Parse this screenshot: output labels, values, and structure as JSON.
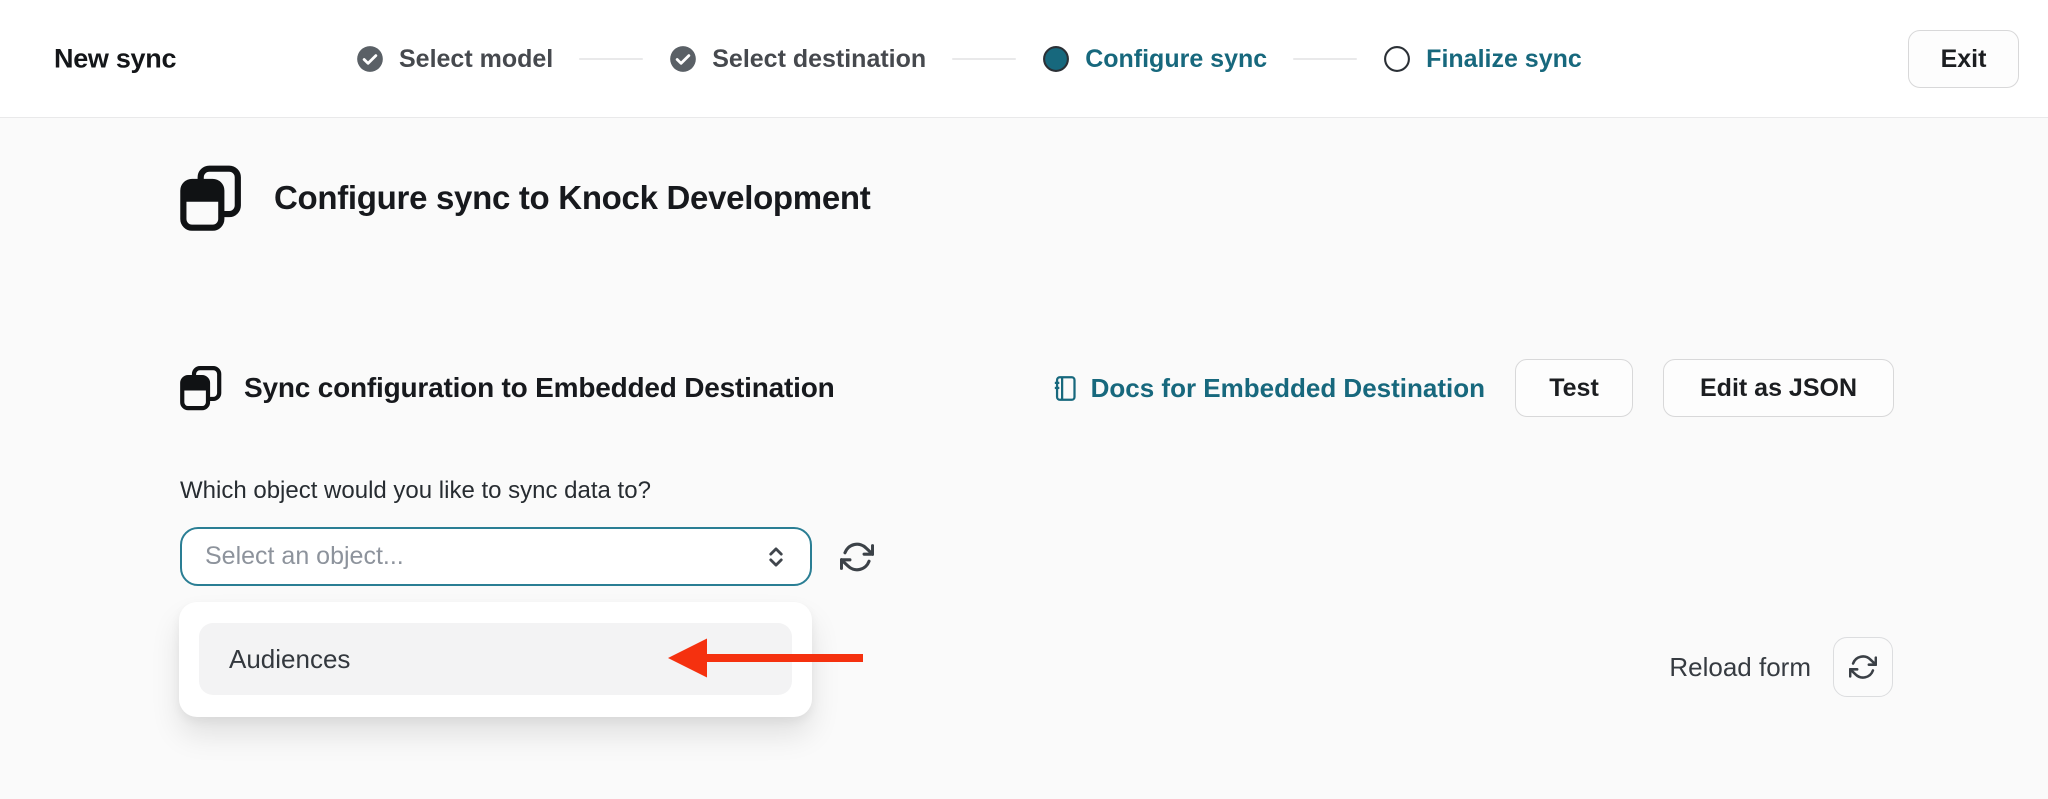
{
  "header": {
    "title": "New sync",
    "exit_label": "Exit",
    "steps": [
      {
        "label": "Select model",
        "state": "completed"
      },
      {
        "label": "Select destination",
        "state": "completed"
      },
      {
        "label": "Configure sync",
        "state": "current"
      },
      {
        "label": "Finalize sync",
        "state": "upcoming"
      }
    ]
  },
  "main": {
    "page_heading": "Configure sync to Knock Development",
    "section": {
      "title": "Sync configuration to Embedded Destination",
      "docs_link_label": "Docs for Embedded Destination",
      "test_button_label": "Test",
      "edit_json_button_label": "Edit as JSON"
    },
    "object_question": "Which object would you like to sync data to?",
    "object_select": {
      "placeholder": "Select an object..."
    },
    "dropdown": {
      "options": [
        "Audiences"
      ]
    },
    "reload_form_label": "Reload form"
  },
  "icons": {
    "step_completed": "check-circle-icon",
    "step_current": "filled-dot-icon",
    "step_upcoming": "empty-circle-icon",
    "heading": "stacked-windows-icon",
    "docs": "notebook-icon",
    "select_caret": "up-down-chevrons-icon",
    "refresh": "refresh-cycle-icon",
    "annotation": "red-left-arrow"
  },
  "colors": {
    "teal_accent": "#17687d",
    "arrow_red": "#f5310f",
    "completed_step_gray": "#5a6066",
    "page_background": "#fafafa",
    "header_background": "#ffffff"
  }
}
